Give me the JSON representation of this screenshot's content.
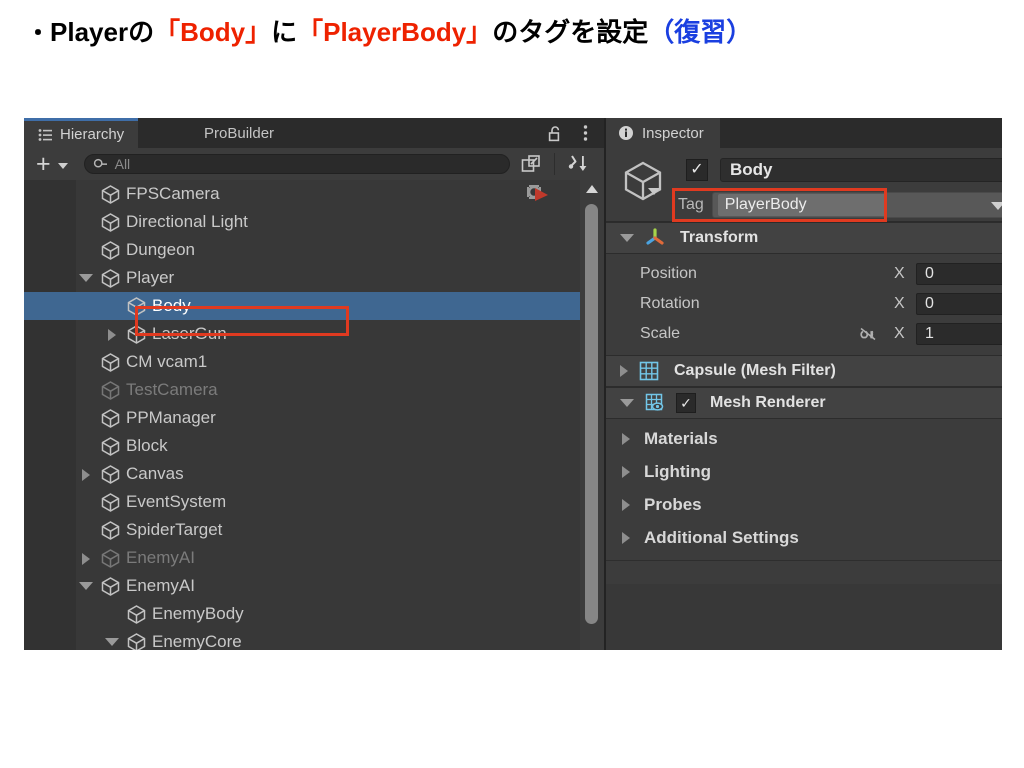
{
  "slide": {
    "bullet": "・",
    "seg1": "Playerの",
    "seg2": "「Body」",
    "seg3": "に",
    "seg4": "「PlayerBody」",
    "seg5": "のタグを設定",
    "seg6": "（復習）",
    "accent_red": "#ee2200",
    "accent_blue": "#1a3fe0"
  },
  "hierarchy": {
    "tabs": [
      {
        "label": "Hierarchy",
        "icon": "hierarchy-icon",
        "active": true
      },
      {
        "label": "ProBuilder",
        "icon": "",
        "active": false
      }
    ],
    "lock_icon": "lock-open-icon",
    "menu_icon": "kebab-menu-icon",
    "toolbar": {
      "add_label": "+",
      "add_caret": "chevron-down-icon",
      "search_icon": "search-icon",
      "search_placeholder": "All",
      "search_value": "",
      "open_window_icon": "open-in-new-icon",
      "sort_icon": "sort-hierarchy-icon"
    },
    "selected": "Body",
    "annotation_color": "#e03a20",
    "rows": [
      {
        "label": "FPSCamera",
        "depth": 1,
        "twisty": "none",
        "dim": false,
        "selected": false,
        "flag": "prefab-warning-icon"
      },
      {
        "label": "Directional Light",
        "depth": 1,
        "twisty": "none",
        "dim": false,
        "selected": false,
        "flag": ""
      },
      {
        "label": "Dungeon",
        "depth": 1,
        "twisty": "none",
        "dim": false,
        "selected": false,
        "flag": ""
      },
      {
        "label": "Player",
        "depth": 1,
        "twisty": "down",
        "dim": false,
        "selected": false,
        "flag": ""
      },
      {
        "label": "Body",
        "depth": 2,
        "twisty": "none",
        "dim": false,
        "selected": true,
        "flag": ""
      },
      {
        "label": "LaserGun",
        "depth": 2,
        "twisty": "right",
        "dim": false,
        "selected": false,
        "flag": ""
      },
      {
        "label": "CM vcam1",
        "depth": 1,
        "twisty": "none",
        "dim": false,
        "selected": false,
        "flag": ""
      },
      {
        "label": "TestCamera",
        "depth": 1,
        "twisty": "none",
        "dim": true,
        "selected": false,
        "flag": ""
      },
      {
        "label": "PPManager",
        "depth": 1,
        "twisty": "none",
        "dim": false,
        "selected": false,
        "flag": ""
      },
      {
        "label": "Block",
        "depth": 1,
        "twisty": "none",
        "dim": false,
        "selected": false,
        "flag": ""
      },
      {
        "label": "Canvas",
        "depth": 1,
        "twisty": "right",
        "dim": false,
        "selected": false,
        "flag": ""
      },
      {
        "label": "EventSystem",
        "depth": 1,
        "twisty": "none",
        "dim": false,
        "selected": false,
        "flag": ""
      },
      {
        "label": "SpiderTarget",
        "depth": 1,
        "twisty": "none",
        "dim": false,
        "selected": false,
        "flag": ""
      },
      {
        "label": "EnemyAI",
        "depth": 1,
        "twisty": "right",
        "dim": true,
        "selected": false,
        "flag": ""
      },
      {
        "label": "EnemyAI",
        "depth": 1,
        "twisty": "down",
        "dim": false,
        "selected": false,
        "flag": ""
      },
      {
        "label": "EnemyBody",
        "depth": 2,
        "twisty": "none",
        "dim": false,
        "selected": false,
        "flag": ""
      },
      {
        "label": "EnemyCore",
        "depth": 2,
        "twisty": "down",
        "dim": false,
        "selected": false,
        "flag": ""
      }
    ]
  },
  "inspector": {
    "tab": {
      "label": "Inspector",
      "icon": "info-icon"
    },
    "object": {
      "icon": "gameobject-cube-icon",
      "enabled_check": "✓",
      "name": "Body",
      "tag_label": "Tag",
      "tag_value": "PlayerBody",
      "tag_caret": "chevron-down-icon"
    },
    "components": [
      {
        "name": "Transform",
        "icon": "transform-axis-icon",
        "expanded": true,
        "has_checkbox": false,
        "properties": [
          {
            "label": "Position",
            "axis": "X",
            "value": "0",
            "link_icon": ""
          },
          {
            "label": "Rotation",
            "axis": "X",
            "value": "0",
            "link_icon": ""
          },
          {
            "label": "Scale",
            "axis": "X",
            "value": "1",
            "link_icon": "link-broken-icon"
          }
        ]
      },
      {
        "name": "Capsule (Mesh Filter)",
        "icon": "mesh-filter-icon",
        "expanded": false,
        "has_checkbox": false,
        "properties": []
      },
      {
        "name": "Mesh Renderer",
        "icon": "mesh-renderer-icon",
        "expanded": true,
        "has_checkbox": true,
        "checkbox_state": "✓",
        "sections": [
          {
            "label": "Materials",
            "twisty": "right"
          },
          {
            "label": "Lighting",
            "twisty": "right"
          },
          {
            "label": "Probes",
            "twisty": "right"
          },
          {
            "label": "Additional Settings",
            "twisty": "right"
          }
        ]
      }
    ]
  }
}
